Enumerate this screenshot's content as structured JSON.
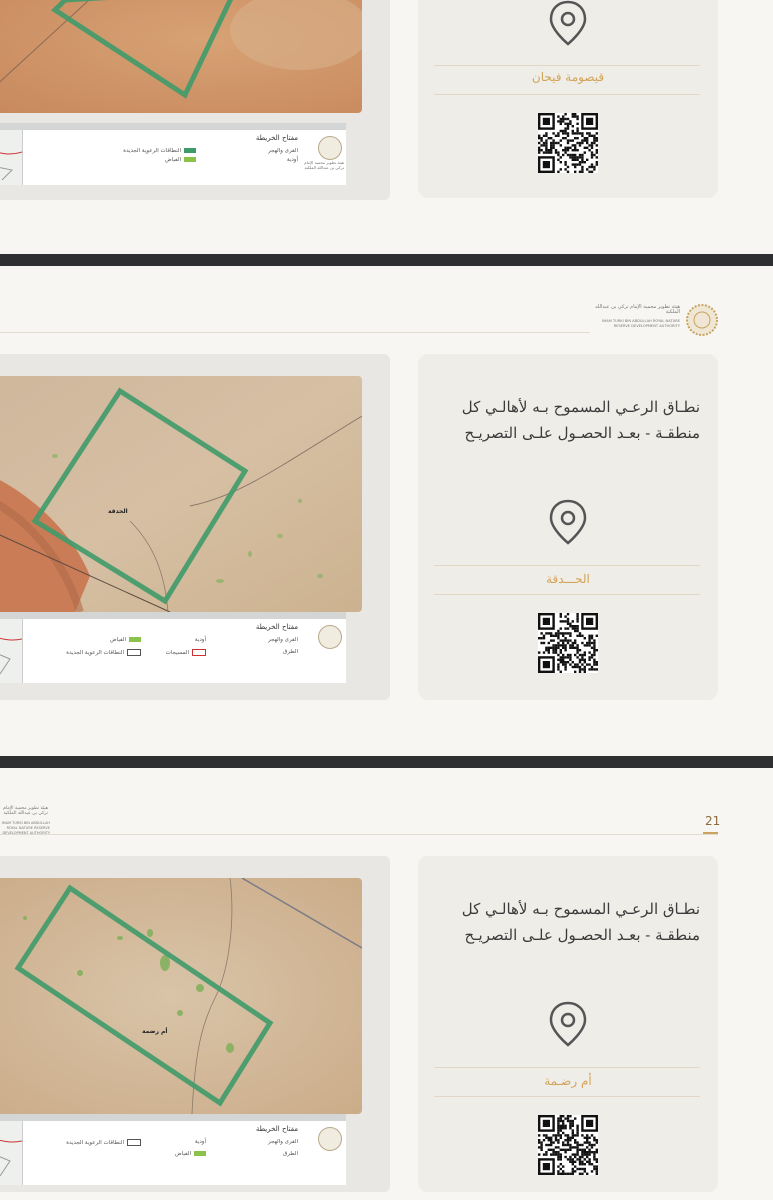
{
  "colors": {
    "accent": "#d2a45a",
    "zone_border": "#3f9a6a",
    "separator": "#2e2f31",
    "card_bg": "#efede8"
  },
  "authority": {
    "arabic": "هيئة تطوير محمية الإمام تركي بن عبدالله الملكية",
    "english": "IMAM TURKI BIN ABDULLAH ROYAL NATURE RESERVE DEVELOPMENT AUTHORITY"
  },
  "sections": [
    {
      "id": "top",
      "place_name": "قيصومة فيحان",
      "legend": {
        "title": "مفتاح الخريطة",
        "items": [
          "القرى والهجر",
          "أودية",
          "النطاقات الرعوية الجديدة",
          "الفياض"
        ]
      }
    },
    {
      "id": "middle",
      "title": "نطـاق الرعـي المسموح بـه لأهالـي كل منطقـة - بعـد الحصـول علـى التصريـح",
      "place_name": "الحـــدقة",
      "map_label": "الحدقة",
      "legend": {
        "title": "مفتاح الخريطة",
        "items": [
          "القرى والهجر",
          "أودية",
          "الفياض",
          "الطرق",
          "المسيجات",
          "النطاقات الرعوية الجديدة"
        ]
      }
    },
    {
      "id": "bottom",
      "page_number": "21",
      "title": "نطـاق الرعـي المسموح بـه لأهالـي كل منطقـة - بعـد الحصـول علـى التصريـح",
      "place_name": "أم رضـمة",
      "map_label": "أم رضمة",
      "legend": {
        "title": "مفتاح الخريطة",
        "items": [
          "القرى والهجر",
          "أودية",
          "الطرق",
          "الفياض",
          "النطاقات الرعوية الجديدة"
        ]
      }
    }
  ],
  "icons": [
    "location-pin-icon",
    "qr-code",
    "authority-emblem"
  ]
}
